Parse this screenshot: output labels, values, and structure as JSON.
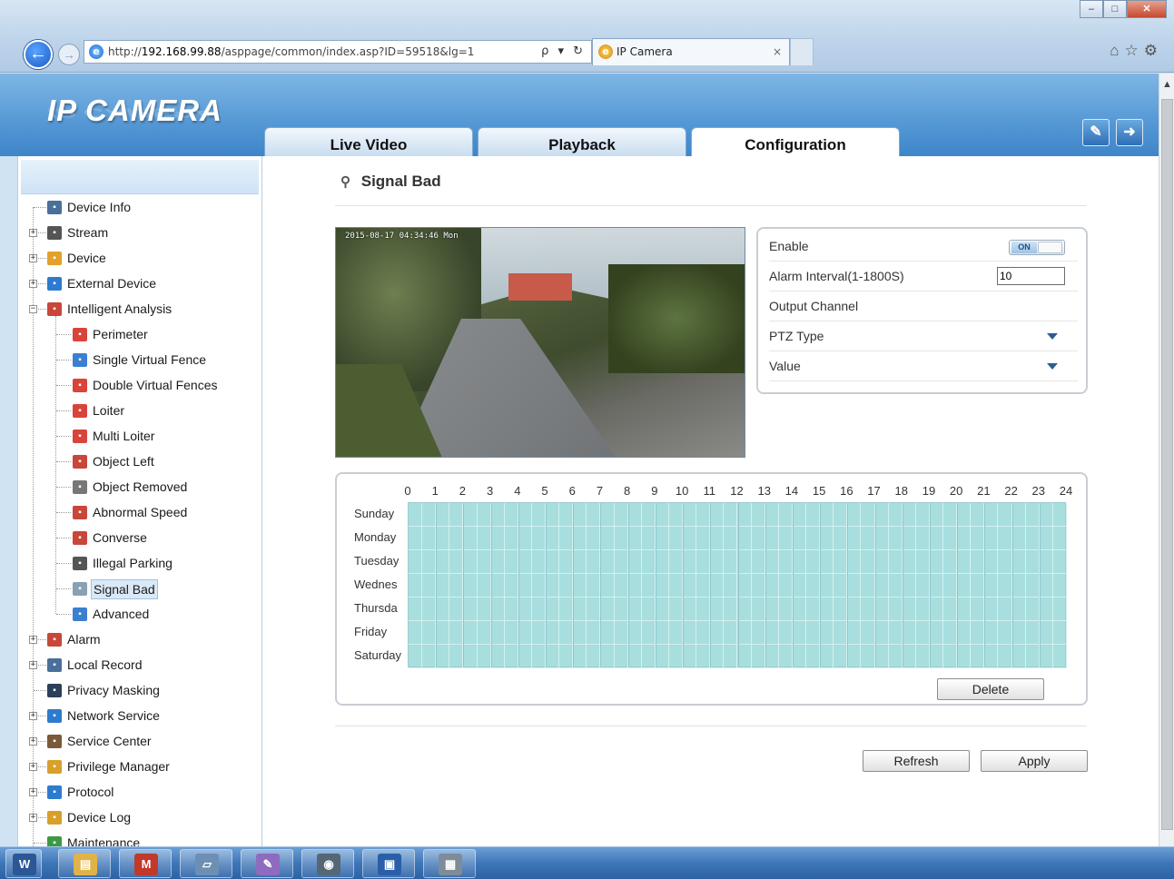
{
  "browser": {
    "address_prefix": "http://",
    "address_host": "192.168.99.88",
    "address_path": "/asppage/common/index.asp?ID=59518&lg=1",
    "address_tools": "ρ ▾ ↻",
    "tab_title": "IP Camera",
    "tab_close": "×",
    "window_minimize": "–",
    "window_maximize": "□",
    "window_close": "✕",
    "right_tools": "⌂☆⚙"
  },
  "header": {
    "logo": "IP CAMERA",
    "tabs": [
      {
        "label": "Live Video"
      },
      {
        "label": "Playback"
      },
      {
        "label": "Configuration"
      }
    ],
    "active_tab": "Configuration",
    "help_icon": "✎",
    "logout_icon": "➜"
  },
  "sidebar": {
    "items": [
      {
        "label": "Device Info",
        "icon": "device-info-icon",
        "color": "#4a6f9a"
      },
      {
        "label": "Stream",
        "icon": "stream-icon",
        "color": "#555555"
      },
      {
        "label": "Device",
        "icon": "device-icon",
        "color": "#e1a12a"
      },
      {
        "label": "External Device",
        "icon": "external-device-icon",
        "color": "#2d7bd1"
      },
      {
        "label": "Intelligent Analysis",
        "icon": "intelligent-analysis-icon",
        "color": "#c8473a"
      },
      {
        "label": "Perimeter",
        "icon": "perimeter-icon",
        "color": "#d9443a"
      },
      {
        "label": "Single Virtual Fence",
        "icon": "single-virtual-fence-icon",
        "color": "#3a7fd0"
      },
      {
        "label": "Double Virtual Fences",
        "icon": "double-virtual-fences-icon",
        "color": "#d9443a"
      },
      {
        "label": "Loiter",
        "icon": "loiter-icon",
        "color": "#d9443a"
      },
      {
        "label": "Multi Loiter",
        "icon": "multi-loiter-icon",
        "color": "#d9443a"
      },
      {
        "label": "Object Left",
        "icon": "object-left-icon",
        "color": "#c8473a"
      },
      {
        "label": "Object Removed",
        "icon": "object-removed-icon",
        "color": "#777777"
      },
      {
        "label": "Abnormal Speed",
        "icon": "abnormal-speed-icon",
        "color": "#c8473a"
      },
      {
        "label": "Converse",
        "icon": "converse-icon",
        "color": "#c8473a"
      },
      {
        "label": "Illegal Parking",
        "icon": "illegal-parking-icon",
        "color": "#555555"
      },
      {
        "label": "Signal Bad",
        "icon": "signal-bad-icon",
        "color": "#8aa0b5"
      },
      {
        "label": "Advanced",
        "icon": "advanced-icon",
        "color": "#3a7fd0"
      },
      {
        "label": "Alarm",
        "icon": "alarm-icon",
        "color": "#c8473a"
      },
      {
        "label": "Local Record",
        "icon": "local-record-icon",
        "color": "#4a6f9a"
      },
      {
        "label": "Privacy Masking",
        "icon": "privacy-masking-icon",
        "color": "#2b3f5a"
      },
      {
        "label": "Network Service",
        "icon": "network-service-icon",
        "color": "#2d7bd1"
      },
      {
        "label": "Service Center",
        "icon": "service-center-icon",
        "color": "#7a5a3a"
      },
      {
        "label": "Privilege Manager",
        "icon": "privilege-manager-icon",
        "color": "#d8a02a"
      },
      {
        "label": "Protocol",
        "icon": "protocol-icon",
        "color": "#2d7bd1"
      },
      {
        "label": "Device Log",
        "icon": "device-log-icon",
        "color": "#d8a02a"
      },
      {
        "label": "Maintenance",
        "icon": "maintenance-icon",
        "color": "#3c9a45"
      }
    ],
    "selected": "Signal Bad"
  },
  "main": {
    "title": "Signal Bad",
    "video_timestamp": "2015-08-17 04:34:46 Mon",
    "settings": {
      "enable_label": "Enable",
      "enable_state": "ON",
      "alarm_interval_label": "Alarm Interval(1-1800S)",
      "alarm_interval_value": "10",
      "output_channel_label": "Output Channel",
      "ptz_type_label": "PTZ Type",
      "value_label": "Value"
    },
    "schedule": {
      "hours": [
        "0",
        "1",
        "2",
        "3",
        "4",
        "5",
        "6",
        "7",
        "8",
        "9",
        "10",
        "11",
        "12",
        "13",
        "14",
        "15",
        "16",
        "17",
        "18",
        "19",
        "20",
        "21",
        "22",
        "23",
        "24"
      ],
      "days": [
        "Sunday",
        "Monday",
        "Tuesday",
        "Wednes",
        "Thursda",
        "Friday",
        "Saturday"
      ],
      "delete_label": "Delete"
    },
    "refresh_label": "Refresh",
    "apply_label": "Apply"
  },
  "taskbar": {
    "apps": [
      {
        "name": "word-icon",
        "glyph": "W",
        "color": "#2b5797"
      },
      {
        "name": "file-explorer-icon",
        "glyph": "▤",
        "color": "#e0b34a"
      },
      {
        "name": "calculator-app-icon",
        "glyph": "M",
        "color": "#c0392b"
      },
      {
        "name": "notepad-icon",
        "glyph": "▱",
        "color": "#6d8fb3"
      },
      {
        "name": "paint-icon",
        "glyph": "✎",
        "color": "#8e6bbf"
      },
      {
        "name": "network-app-icon",
        "glyph": "◉",
        "color": "#567"
      },
      {
        "name": "remote-desktop-icon",
        "glyph": "▣",
        "color": "#2a5fa8"
      },
      {
        "name": "calculator-icon",
        "glyph": "▦",
        "color": "#7e8c99"
      }
    ]
  }
}
